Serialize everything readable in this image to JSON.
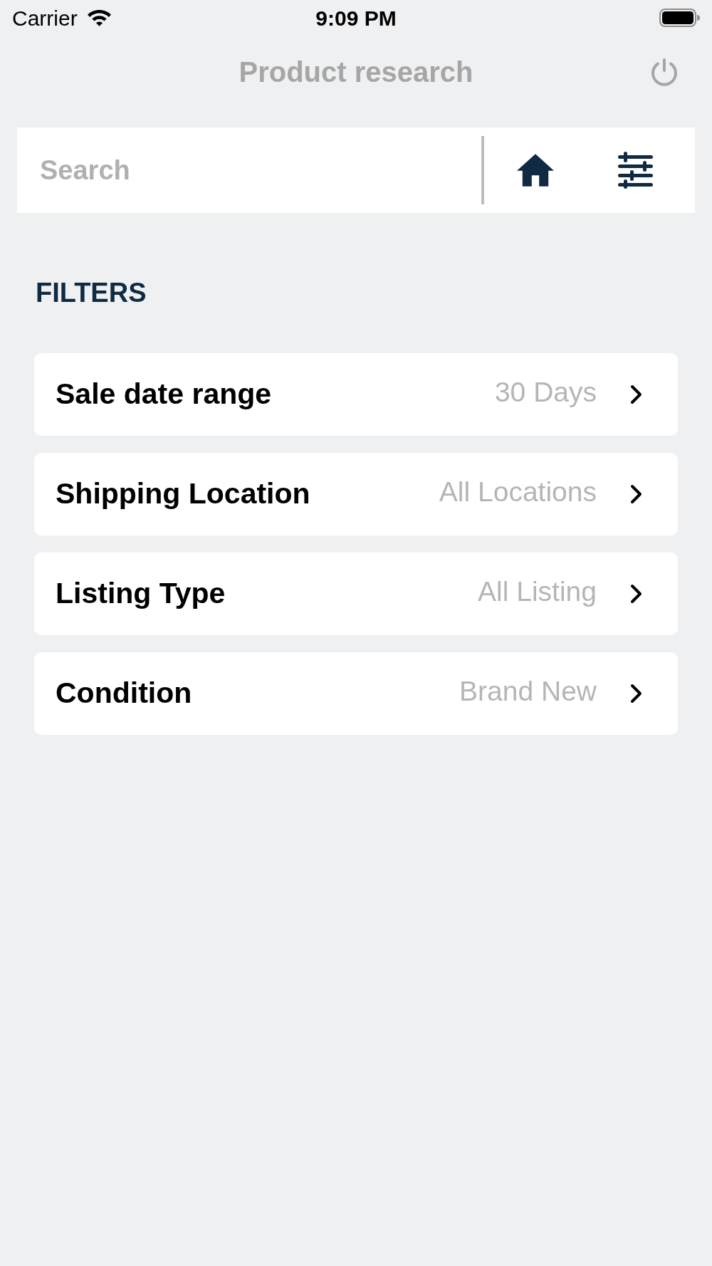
{
  "status_bar": {
    "carrier": "Carrier",
    "time": "9:09 PM"
  },
  "header": {
    "title": "Product research"
  },
  "search": {
    "placeholder": "Search"
  },
  "filters": {
    "heading": "FILTERS",
    "items": [
      {
        "label": "Sale date range",
        "value": "30 Days"
      },
      {
        "label": "Shipping Location",
        "value": "All Locations"
      },
      {
        "label": "Listing Type",
        "value": "All Listing"
      },
      {
        "label": "Condition",
        "value": "Brand New"
      }
    ]
  }
}
